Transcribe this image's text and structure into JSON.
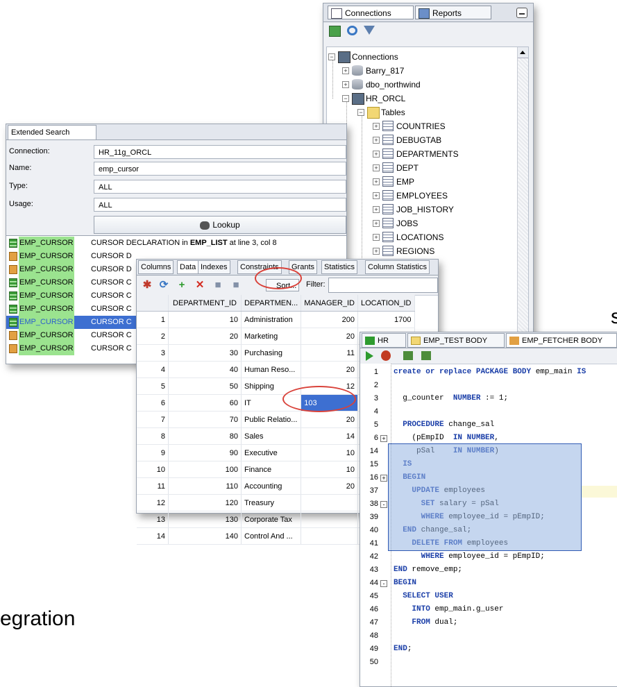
{
  "slide": {
    "partial_word_top": "s",
    "partial_word_bottom": "egration"
  },
  "connections_panel": {
    "tabs": [
      "Connections",
      "Reports"
    ],
    "root": "Connections",
    "nodes": [
      "Barry_817",
      "dbo_northwind",
      "HR_ORCL"
    ],
    "tables_folder": "Tables",
    "tables": [
      "COUNTRIES",
      "DEBUGTAB",
      "DEPARTMENTS",
      "DEPT",
      "EMP",
      "EMPLOYEES",
      "JOB_HISTORY",
      "JOBS",
      "LOCATIONS",
      "REGIONS"
    ]
  },
  "extended_search": {
    "tab": "Extended Search",
    "fields": [
      {
        "label": "Connection:",
        "value": "HR_11g_ORCL"
      },
      {
        "label": "Name:",
        "value": "emp_cursor"
      },
      {
        "label": "Type:",
        "value": "ALL"
      },
      {
        "label": "Usage:",
        "value": "ALL"
      }
    ],
    "lookup_label": "Lookup",
    "first_result": {
      "name": "EMP_CURSOR",
      "pre": "CURSOR DECLARATION in ",
      "bold": "EMP_LIST",
      "post": " at line 3, col 8"
    },
    "results": [
      {
        "name": "EMP_CURSOR",
        "desc": "CURSOR D"
      },
      {
        "name": "EMP_CURSOR",
        "desc": "CURSOR D"
      },
      {
        "name": "EMP_CURSOR",
        "desc": "CURSOR C"
      },
      {
        "name": "EMP_CURSOR",
        "desc": "CURSOR C"
      },
      {
        "name": "EMP_CURSOR",
        "desc": "CURSOR C"
      },
      {
        "name": "EMP_CURSOR",
        "desc": "CURSOR C"
      },
      {
        "name": "EMP_CURSOR",
        "desc": "CURSOR C"
      },
      {
        "name": "EMP_CURSOR",
        "desc": "CURSOR C"
      }
    ]
  },
  "data_grid": {
    "tabs": [
      "Columns",
      "Data",
      "Indexes",
      "Constraints",
      "Grants",
      "Statistics",
      "Column Statistics"
    ],
    "sort_label": "Sort...",
    "filter_label": "Filter:",
    "headers": [
      "DEPARTMENT_ID",
      "DEPARTMEN...",
      "MANAGER_ID",
      "LOCATION_ID"
    ],
    "rows": [
      [
        "1",
        "10",
        "Administration",
        "200",
        "1700"
      ],
      [
        "2",
        "20",
        "Marketing",
        "20",
        ""
      ],
      [
        "3",
        "30",
        "Purchasing",
        "11",
        ""
      ],
      [
        "4",
        "40",
        "Human Reso...",
        "20",
        ""
      ],
      [
        "5",
        "50",
        "Shipping",
        "12",
        ""
      ],
      [
        "6",
        "60",
        "IT",
        "103",
        ""
      ],
      [
        "7",
        "70",
        "Public Relatio...",
        "20",
        ""
      ],
      [
        "8",
        "80",
        "Sales",
        "14",
        ""
      ],
      [
        "9",
        "90",
        "Executive",
        "10",
        ""
      ],
      [
        "10",
        "100",
        "Finance",
        "10",
        ""
      ],
      [
        "11",
        "110",
        "Accounting",
        "20",
        ""
      ],
      [
        "12",
        "120",
        "Treasury",
        "",
        ""
      ],
      [
        "13",
        "130",
        "Corporate Tax",
        "",
        ""
      ],
      [
        "14",
        "140",
        "Control And ...",
        "",
        ""
      ]
    ]
  },
  "code_editor": {
    "tabs": [
      "HR",
      "EMP_TEST BODY",
      "EMP_FETCHER BODY"
    ],
    "lines": [
      {
        "n": "1",
        "fold": "",
        "code": "create or replace PACKAGE BODY emp_main IS"
      },
      {
        "n": "2",
        "fold": "",
        "code": ""
      },
      {
        "n": "3",
        "fold": "",
        "code": "  g_counter  NUMBER := 1;"
      },
      {
        "n": "4",
        "fold": "",
        "code": ""
      },
      {
        "n": "5",
        "fold": "",
        "code": "  PROCEDURE change_sal"
      },
      {
        "n": "6",
        "fold": "+",
        "code": "    (pEmpID  IN NUMBER,"
      },
      {
        "n": "14",
        "fold": "",
        "code": "     pSal    IN NUMBER)"
      },
      {
        "n": "15",
        "fold": "",
        "code": "  IS"
      },
      {
        "n": "16",
        "fold": "+",
        "code": "  BEGIN"
      },
      {
        "n": "37",
        "fold": "",
        "code": "    UPDATE employees"
      },
      {
        "n": "38",
        "fold": "-",
        "code": "      SET salary = pSal"
      },
      {
        "n": "39",
        "fold": "",
        "code": "      WHERE employee_id = pEmpID;"
      },
      {
        "n": "40",
        "fold": "",
        "code": "  END change_sal;"
      },
      {
        "n": "41",
        "fold": "",
        "code": "    DELETE FROM employees"
      },
      {
        "n": "42",
        "fold": "",
        "code": "      WHERE employee_id = pEmpID;"
      },
      {
        "n": "43",
        "fold": "",
        "code": "END remove_emp;"
      },
      {
        "n": "44",
        "fold": "-",
        "code": "BEGIN"
      },
      {
        "n": "45",
        "fold": "",
        "code": "  SELECT USER"
      },
      {
        "n": "46",
        "fold": "",
        "code": "    INTO emp_main.g_user"
      },
      {
        "n": "47",
        "fold": "",
        "code": "    FROM dual;"
      },
      {
        "n": "48",
        "fold": "",
        "code": ""
      },
      {
        "n": "49",
        "fold": "",
        "code": "END;"
      },
      {
        "n": "50",
        "fold": "",
        "code": ""
      }
    ]
  },
  "colors": {
    "accent_red": "#d9423a",
    "selection": "#96b4e1",
    "result_highlight": "#9be38f",
    "selected_row": "#3d6fd1"
  }
}
